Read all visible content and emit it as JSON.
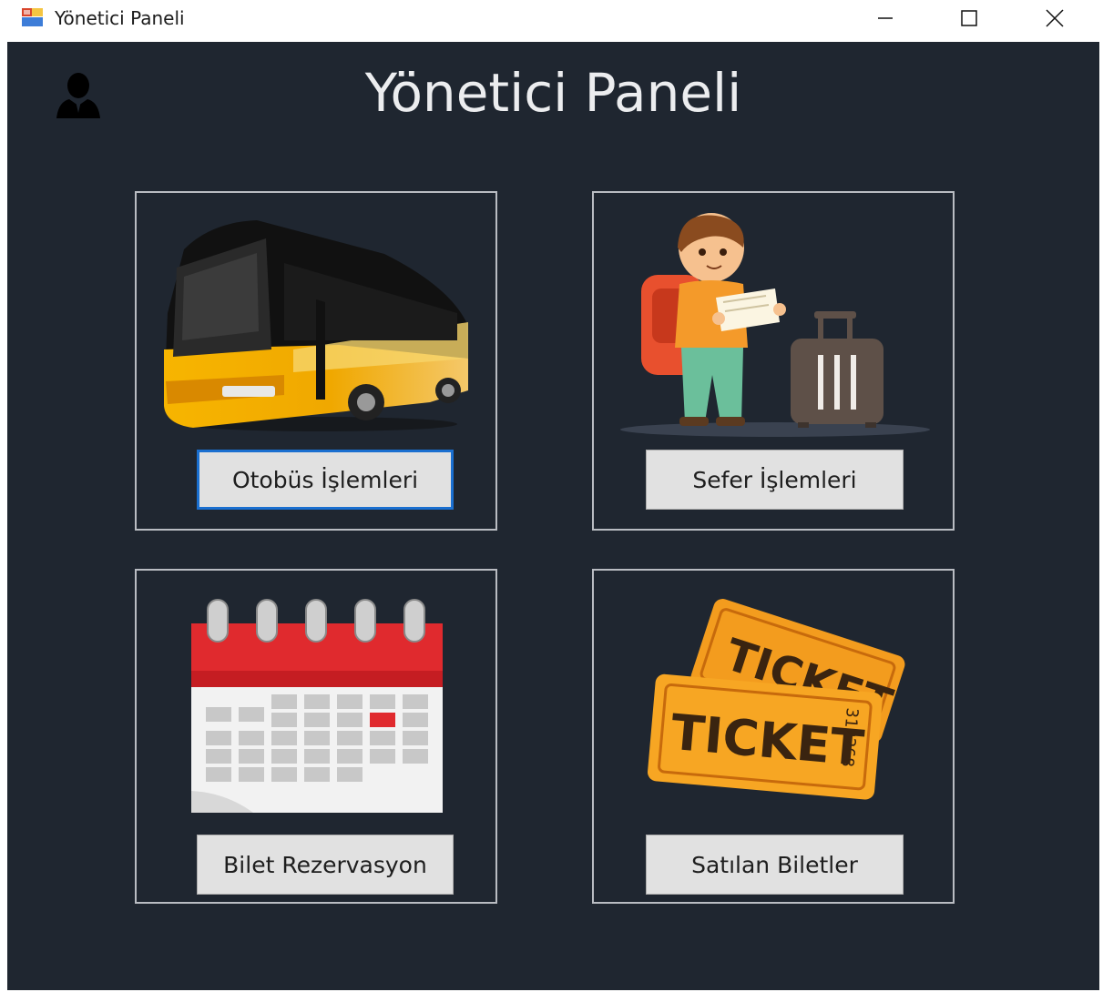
{
  "window": {
    "title": "Yönetici Paneli"
  },
  "header": {
    "title": "Yönetici Paneli"
  },
  "panels": [
    {
      "button_label": "Otobüs İşlemleri",
      "image": "bus-image",
      "focused": true
    },
    {
      "button_label": "Sefer İşlemleri",
      "image": "traveler-image"
    },
    {
      "button_label": "Bilet Rezervasyon",
      "image": "calendar-image"
    },
    {
      "button_label": "Satılan Biletler",
      "image": "ticket-image"
    }
  ],
  "tickets": {
    "front_text": "TICKET",
    "back_text": "TICKET",
    "serial": "312268"
  },
  "colors": {
    "background": "#1f2630",
    "panel_border": "#b9bcc2",
    "button_bg": "#e1e1e1",
    "focus_border": "#1a6fd0"
  }
}
